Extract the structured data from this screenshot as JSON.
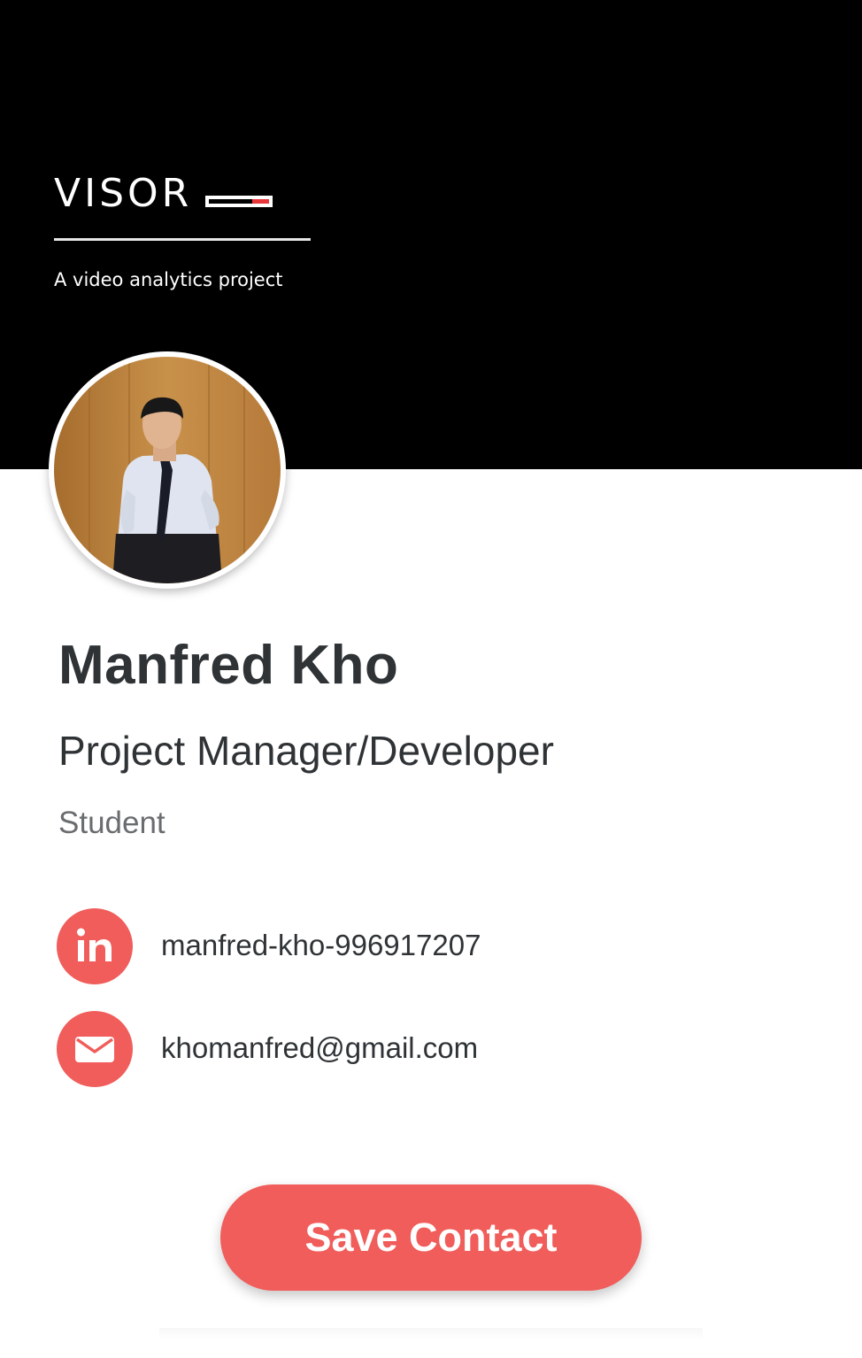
{
  "header": {
    "logo_text": "VISOR",
    "tagline": "A video analytics project"
  },
  "profile": {
    "name": "Manfred Kho",
    "title": "Project Manager/Developer",
    "subtitle": "Student"
  },
  "contacts": [
    {
      "icon": "linkedin-icon",
      "value": "manfred-kho-996917207"
    },
    {
      "icon": "email-icon",
      "value": "khomanfred@gmail.com"
    }
  ],
  "actions": {
    "save_label": "Save Contact"
  },
  "colors": {
    "accent": "#f05d5a",
    "header_bg": "#000000",
    "text_dark": "#2f3336",
    "text_muted": "#6a6d70",
    "logo_mark_red": "#e8353a"
  }
}
